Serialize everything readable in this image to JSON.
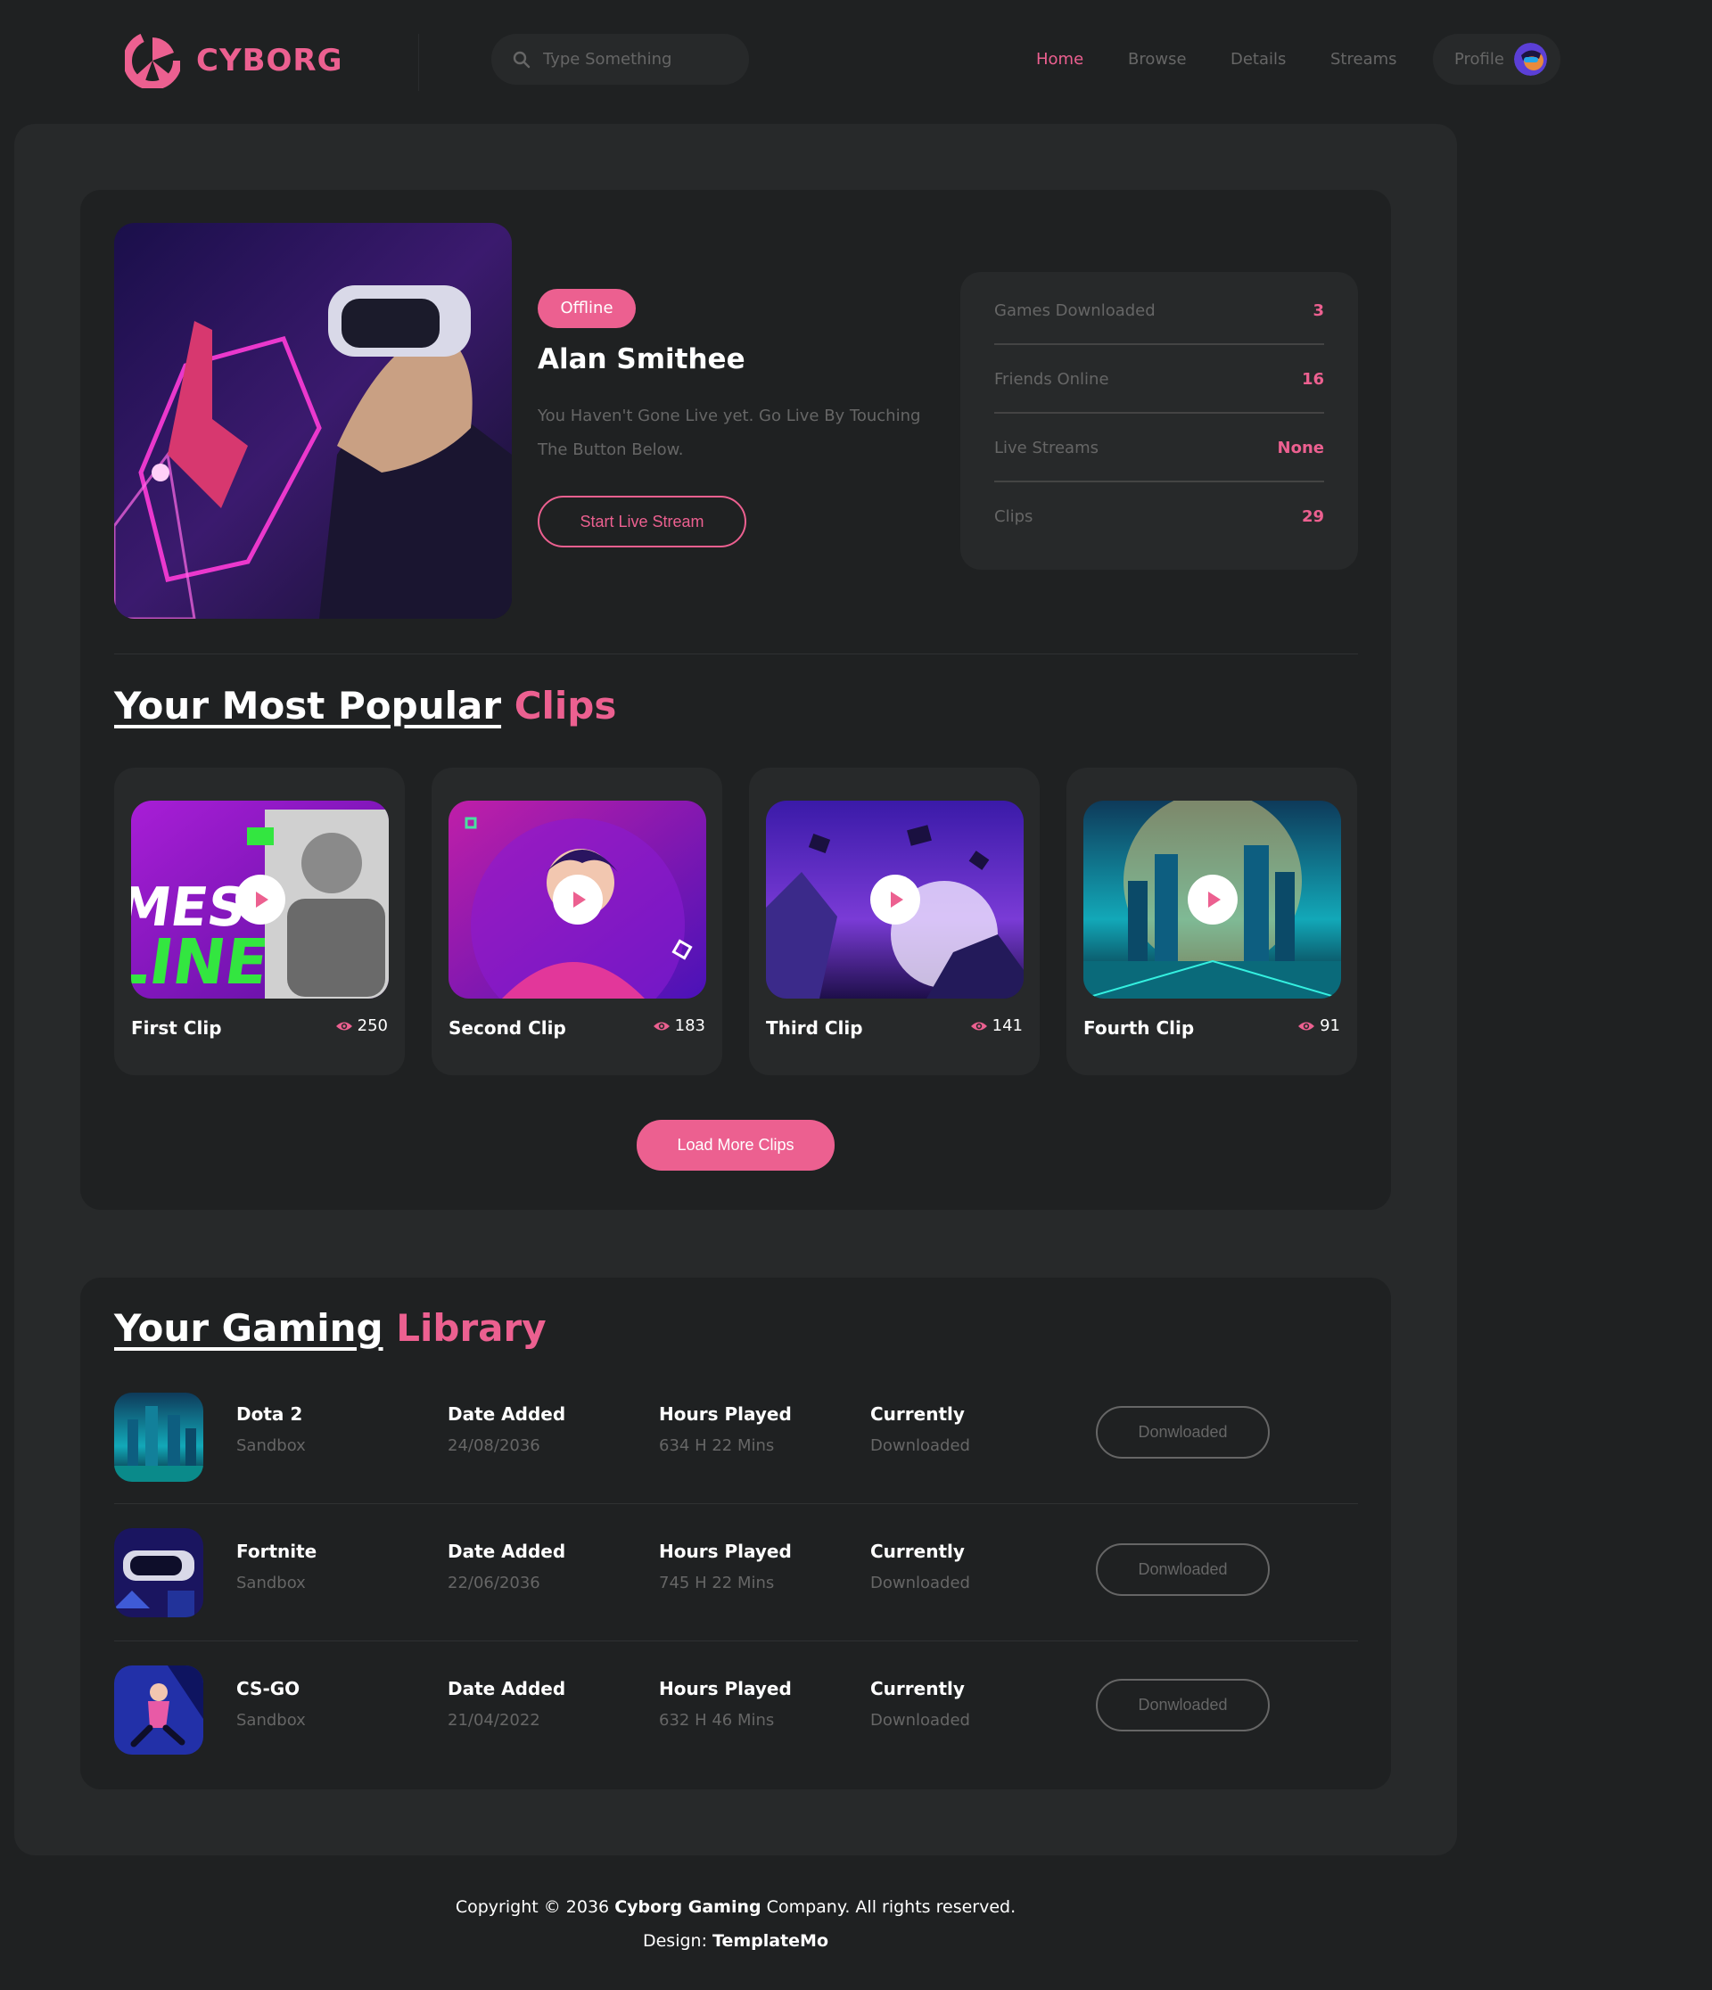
{
  "brand": {
    "name": "CYBORG",
    "accent": "#ec6090",
    "background": "#1f2122",
    "panel": "#27292a"
  },
  "search": {
    "placeholder": "Type Something",
    "icon": "search-icon"
  },
  "nav": {
    "items": [
      {
        "label": "Home",
        "active": true
      },
      {
        "label": "Browse",
        "active": false
      },
      {
        "label": "Details",
        "active": false
      },
      {
        "label": "Streams",
        "active": false
      }
    ],
    "profile_label": "Profile"
  },
  "profile": {
    "status_badge": "Offline",
    "name": "Alan Smithee",
    "description": "You Haven't Gone Live yet. Go Live By Touching The Button Below.",
    "cta": "Start Live Stream",
    "stats": [
      {
        "label": "Games Downloaded",
        "value": "3"
      },
      {
        "label": "Friends Online",
        "value": "16"
      },
      {
        "label": "Live Streams",
        "value": "None"
      },
      {
        "label": "Clips",
        "value": "29"
      }
    ]
  },
  "clips": {
    "heading_plain": "Your Most Popular",
    "heading_accent": "Clips",
    "items": [
      {
        "title": "First Clip",
        "views": "250"
      },
      {
        "title": "Second Clip",
        "views": "183"
      },
      {
        "title": "Third Clip",
        "views": "141"
      },
      {
        "title": "Fourth Clip",
        "views": "91"
      }
    ],
    "load_more": "Load More Clips"
  },
  "library": {
    "heading_plain": "Your Gaming",
    "heading_accent": "Library",
    "rows": [
      {
        "game": "Dota 2",
        "category": "Sandbox",
        "date_label": "Date Added",
        "date": "24/08/2036",
        "hours_label": "Hours Played",
        "hours": "634 H 22 Mins",
        "status_label": "Currently",
        "status": "Downloaded",
        "button": "Donwloaded"
      },
      {
        "game": "Fortnite",
        "category": "Sandbox",
        "date_label": "Date Added",
        "date": "22/06/2036",
        "hours_label": "Hours Played",
        "hours": "745 H 22 Mins",
        "status_label": "Currently",
        "status": "Downloaded",
        "button": "Donwloaded"
      },
      {
        "game": "CS-GO",
        "category": "Sandbox",
        "date_label": "Date Added",
        "date": "21/04/2022",
        "hours_label": "Hours Played",
        "hours": "632 H 46 Mins",
        "status_label": "Currently",
        "status": "Downloaded",
        "button": "Donwloaded"
      }
    ]
  },
  "footer": {
    "copyright_prefix": "Copyright © 2036",
    "company": "Cyborg Gaming",
    "copyright_suffix": "Company. All rights reserved.",
    "design_label": "Design:",
    "designer": "TemplateMo"
  }
}
